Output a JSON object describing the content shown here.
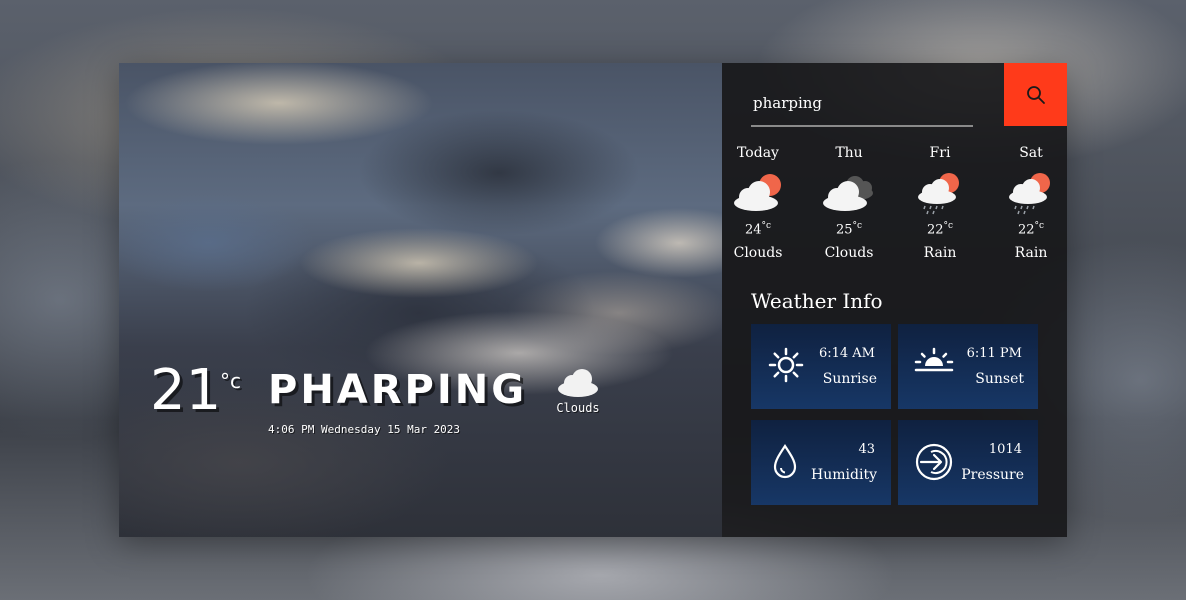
{
  "hero": {
    "temperature": "21",
    "temp_unit": "°c",
    "city": "PHARPING",
    "datetime": "4:06 PM Wednesday 15 Mar 2023",
    "condition": "Clouds",
    "condition_icon": "cloud-icon"
  },
  "search": {
    "value": "pharping",
    "button_icon": "search-icon"
  },
  "forecast": [
    {
      "day": "Today",
      "temp": "24",
      "unit": "°c",
      "condition": "Clouds",
      "icon": "sun-cloud-icon"
    },
    {
      "day": "Thu",
      "temp": "25",
      "unit": "°c",
      "condition": "Clouds",
      "icon": "dark-cloud-icon"
    },
    {
      "day": "Fri",
      "temp": "22",
      "unit": "°c",
      "condition": "Rain",
      "icon": "sun-rain-icon"
    },
    {
      "day": "Sat",
      "temp": "22",
      "unit": "°c",
      "condition": "Rain",
      "icon": "sun-rain-icon"
    }
  ],
  "weather_info": {
    "title": "Weather Info",
    "sunrise": {
      "value": "6:14 AM",
      "label": "Sunrise",
      "icon": "sun-icon"
    },
    "sunset": {
      "value": "6:11 PM",
      "label": "Sunset",
      "icon": "sunset-icon"
    },
    "humidity": {
      "value": "43",
      "label": "Humidity",
      "icon": "droplet-icon"
    },
    "pressure": {
      "value": "1014",
      "label": "Pressure",
      "icon": "pressure-icon"
    }
  },
  "colors": {
    "accent": "#ff3a1a",
    "tile_bg": "#173766",
    "panel_bg": "#161618"
  }
}
